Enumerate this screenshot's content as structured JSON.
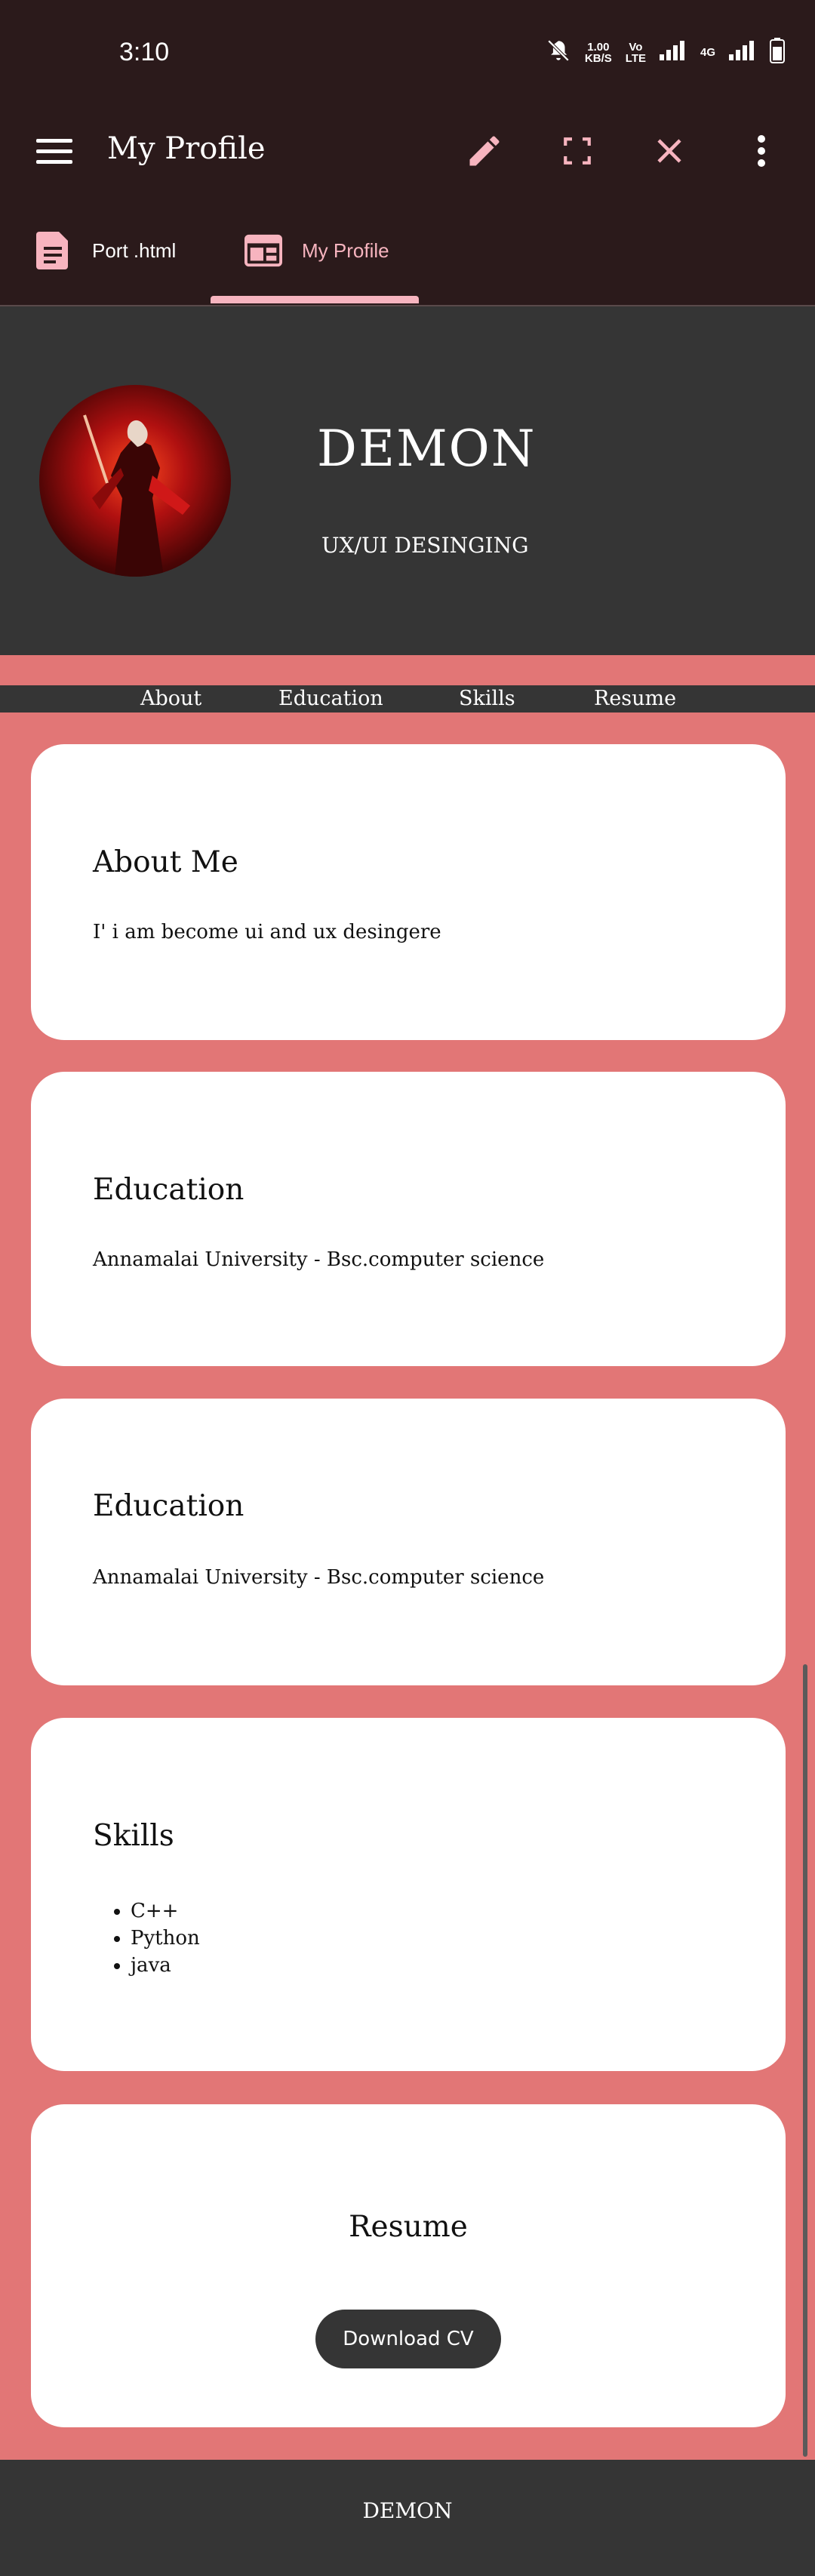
{
  "status_bar": {
    "time": "3:10",
    "net_speed_value": "1.00",
    "net_speed_unit": "KB/S",
    "volte_top": "Vo",
    "volte_bottom": "LTE",
    "network_label": "4G"
  },
  "toolbar": {
    "title": "My Profile"
  },
  "tabs": [
    {
      "label": "Port .html"
    },
    {
      "label": "My Profile"
    }
  ],
  "hero": {
    "name": "DEMON",
    "subtitle": "UX/UI DESINGING"
  },
  "nav": {
    "items": [
      "About",
      "Education",
      "Skills",
      "Resume"
    ]
  },
  "about": {
    "heading": "About Me",
    "text": "I' i am become ui and ux desingere"
  },
  "education": [
    {
      "heading": "Education",
      "text": "Annamalai University - Bsc.computer science"
    },
    {
      "heading": "Education",
      "text": "Annamalai University - Bsc.computer science"
    }
  ],
  "skills": {
    "heading": "Skills",
    "items": [
      "C++",
      "Python",
      "java"
    ]
  },
  "resume": {
    "heading": "Resume",
    "button_label": "Download CV"
  },
  "footer": {
    "text": "DEMON"
  },
  "colors": {
    "background_pink": "#e27676",
    "dark_panel": "#353535",
    "app_bar": "#2b1a1b",
    "tab_accent": "#f7b4bf"
  }
}
